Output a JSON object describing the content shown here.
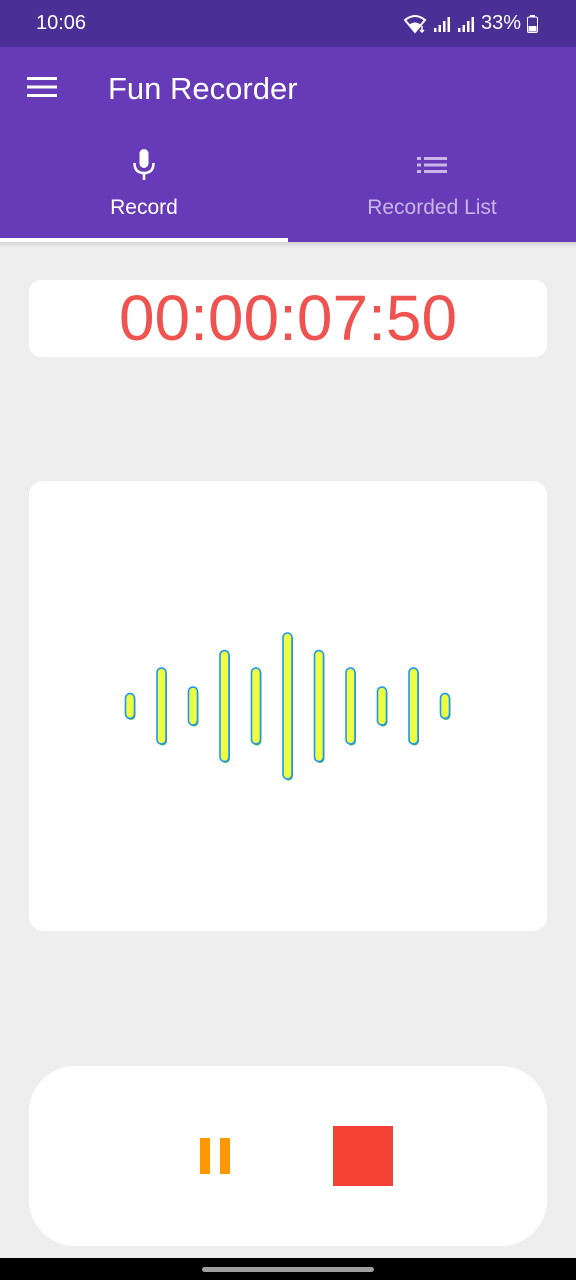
{
  "status_bar": {
    "time": "10:06",
    "battery": "33%"
  },
  "app_bar": {
    "title": "Fun Recorder",
    "menu_icon": "hamburger-menu-icon"
  },
  "tabs": [
    {
      "label": "Record",
      "icon": "microphone-icon",
      "active": true
    },
    {
      "label": "Recorded List",
      "icon": "list-icon",
      "active": false
    }
  ],
  "timer": {
    "elapsed": "00:00:07:50",
    "color": "#ef5350"
  },
  "waveform": {
    "bar_fill": "#eeff41",
    "bar_stroke": "#4caf50",
    "bar_stroke_accent": "#2196f3",
    "levels": [
      0.17,
      0.52,
      0.26,
      0.76,
      0.52,
      1.0,
      0.76,
      0.52,
      0.26,
      0.52,
      0.17
    ]
  },
  "controls": {
    "pause_icon": "pause-icon",
    "pause_color": "#ff9800",
    "stop_icon": "stop-icon",
    "stop_color": "#f44336"
  },
  "colors": {
    "app_bar": "#673ab7",
    "status_bar": "#4a2f96",
    "background": "#eeeeee"
  }
}
